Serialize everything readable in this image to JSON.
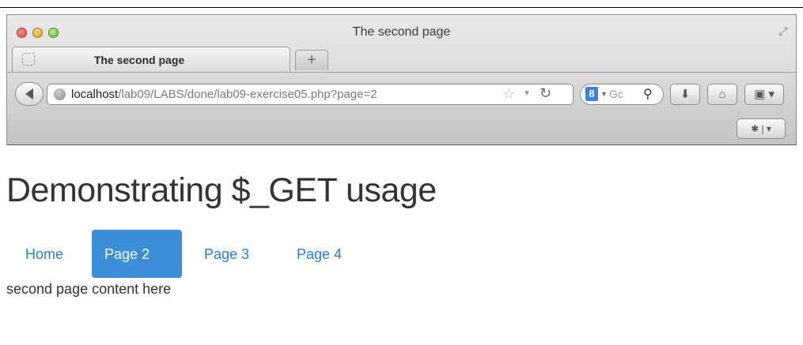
{
  "browser": {
    "window_title": "The second page",
    "tab": {
      "label": "The second page",
      "new_tab_glyph": "+"
    },
    "url": {
      "host": "localhost",
      "path": "/lab09/LABS/done/lab09-exercise05.php?page=2"
    },
    "search": {
      "engine_glyph": "8",
      "text": "Gc"
    },
    "icons": [
      "back-icon",
      "globe-icon",
      "star-icon",
      "reload-icon",
      "search-icon",
      "download-icon",
      "home-icon",
      "bookmarks-icon",
      "extension-icon"
    ]
  },
  "page": {
    "heading": "Demonstrating $_GET usage",
    "nav": [
      {
        "label": "Home",
        "active": false
      },
      {
        "label": "Page 2",
        "active": true
      },
      {
        "label": "Page 3",
        "active": false
      },
      {
        "label": "Page 4",
        "active": false
      }
    ],
    "content": "second page content here",
    "colors": {
      "active_pill": "#3b8fd9",
      "link": "#2a7bd6",
      "text": "#333333"
    }
  }
}
